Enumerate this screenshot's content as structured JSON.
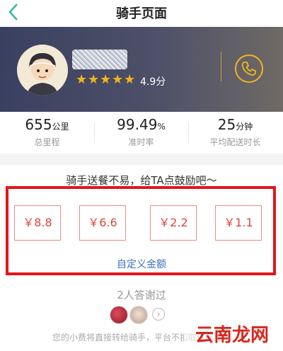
{
  "nav": {
    "title": "骑手页面"
  },
  "rider": {
    "rating": "4.9分",
    "star_count": 5,
    "star_color": "#f3b51c"
  },
  "stats": [
    {
      "value": "655",
      "unit": "公里",
      "label": "总里程"
    },
    {
      "value": "99.49",
      "unit": "%",
      "label": "准时率"
    },
    {
      "value": "25",
      "unit": "分钟",
      "label": "平均配送时长"
    }
  ],
  "encourage_text": "骑手送餐不易，给TA点鼓励吧～",
  "tips": [
    "￥8.8",
    "￥6.6",
    "￥2.2",
    "￥1.1"
  ],
  "custom_amount": "自定义金额",
  "thanked_count": "2人答谢过",
  "footer_note": "您的小费将直接转给骑手，平台不扣取任何费用",
  "watermark": "云南龙网",
  "colors": {
    "accent": "#f3b51c",
    "tip_red": "#e0443a",
    "highlight_frame": "#e5141b",
    "link_blue": "#3a6fbf"
  }
}
